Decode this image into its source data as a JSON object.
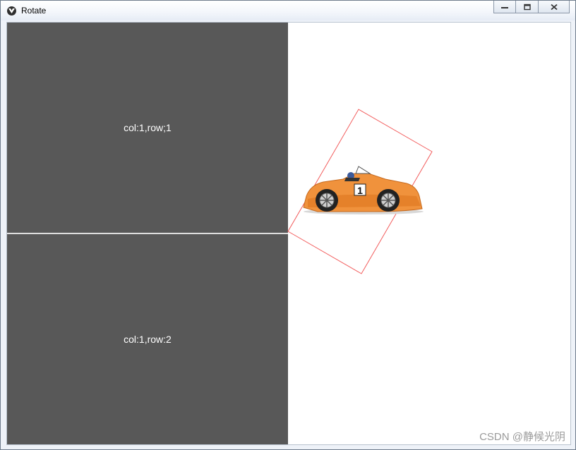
{
  "window": {
    "title": "Rotate",
    "controls": {
      "minimize": "minimize-icon",
      "maximize": "restore-icon",
      "close": "close-icon"
    }
  },
  "grid": {
    "cells": [
      {
        "label": "col:1,row;1"
      },
      {
        "label": "col:1,row:2"
      }
    ]
  },
  "car": {
    "number": "1",
    "colors": {
      "body": "#f0923c",
      "box_outline": "#f25c5c"
    }
  },
  "colors": {
    "cell_bg": "#585858",
    "title_bar": "#f3f6fb"
  },
  "watermark": "CSDN @静候光阴"
}
